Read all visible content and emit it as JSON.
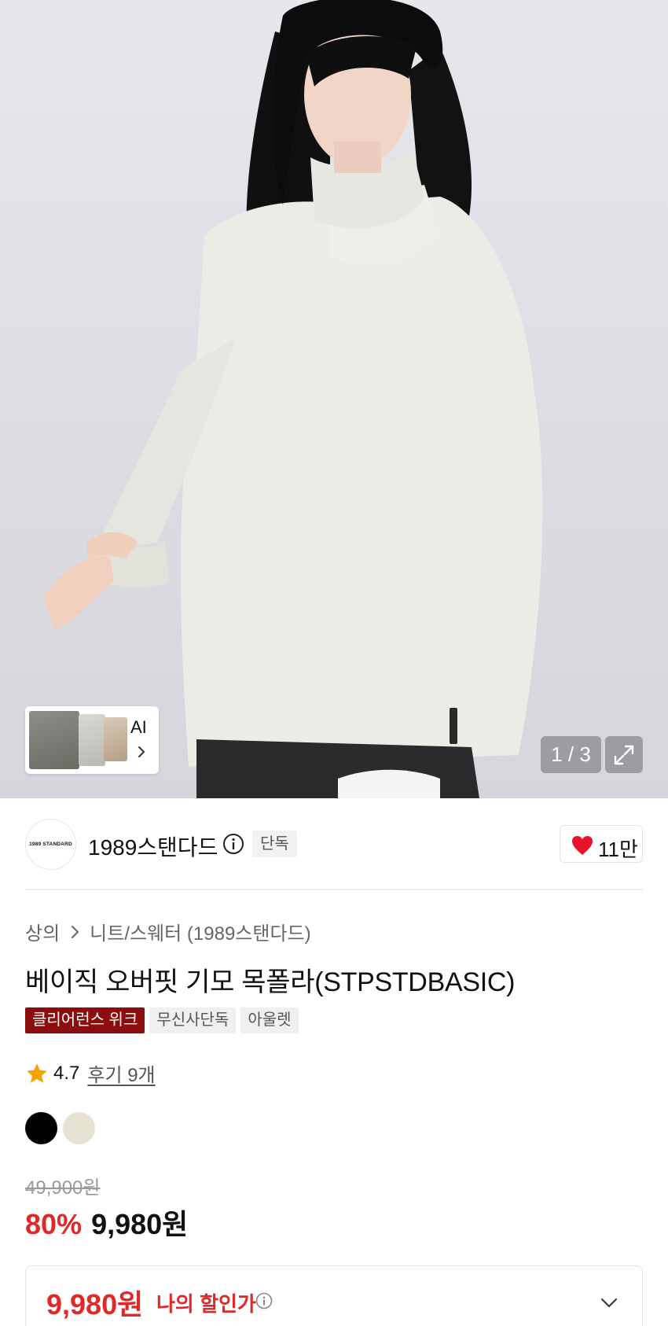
{
  "gallery": {
    "ai_label": "AI",
    "counter": "1 / 3"
  },
  "brand": {
    "logo_text": "1989 STANDARD",
    "name": "1989스탠다드",
    "exclusive_badge": "단독",
    "like_count": "11만"
  },
  "product": {
    "breadcrumb": [
      "상의",
      "니트/스웨터 (1989스탠다드)"
    ],
    "title": "베이직 오버핏 기모 목폴라(STPSTDBASIC)",
    "tags": [
      "클리어런스 위크",
      "무신사단독",
      "아울렛"
    ],
    "rating": "4.7",
    "reviews": "후기 9개",
    "colors": [
      "#000000",
      "#e6e3d2"
    ],
    "original_price": "49,900원",
    "discount": "80%",
    "sale_price": "9,980원",
    "my_price": "9,980원",
    "my_price_label": "나의 할인가"
  },
  "icons": {
    "ai_chevron": "chevron-right-icon",
    "expand": "expand-icon",
    "brand_info": "info-icon",
    "like": "heart-icon",
    "breadcrumb_sep": "chevron-right-icon",
    "rating_star": "star-icon",
    "my_price_info": "info-icon",
    "my_price_toggle": "chevron-down-icon"
  },
  "colors": {
    "accent_red": "#e02828",
    "clearance_tag": "#8c0d0d",
    "heart": "#e8132b"
  }
}
